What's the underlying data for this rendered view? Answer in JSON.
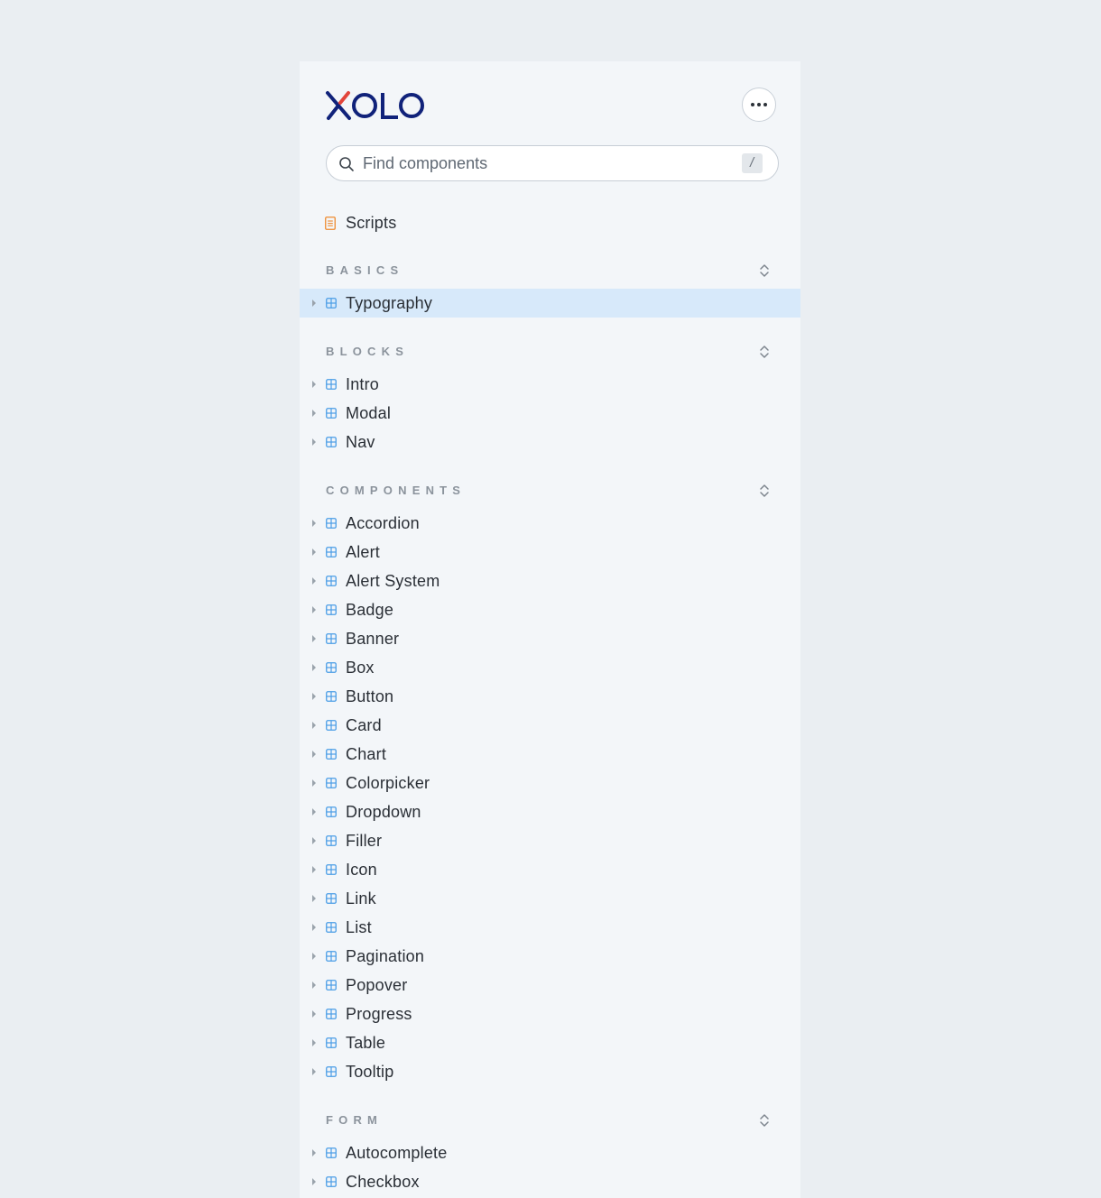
{
  "brand": {
    "logo_text": "XOLO",
    "logo_color": "#10227a",
    "logo_accent_color": "#e2453b"
  },
  "header": {
    "more_icon": "more-horizontal-icon"
  },
  "search": {
    "placeholder": "Find components",
    "value": "",
    "shortcut": "/",
    "icon": "search-icon"
  },
  "colors": {
    "page_background": "#eaeef2",
    "sidebar_background": "#f3f6f9",
    "selected_row": "#d7e9fa",
    "component_icon": "#4a9de6",
    "doc_icon": "#ee8a2f",
    "section_title": "#8b939c"
  },
  "docs": [
    {
      "label": "Scripts",
      "icon": "document-icon"
    }
  ],
  "sections": [
    {
      "title": "BASICS",
      "items": [
        {
          "label": "Typography",
          "selected": true
        }
      ]
    },
    {
      "title": "BLOCKS",
      "items": [
        {
          "label": "Intro"
        },
        {
          "label": "Modal"
        },
        {
          "label": "Nav"
        }
      ]
    },
    {
      "title": "COMPONENTS",
      "items": [
        {
          "label": "Accordion"
        },
        {
          "label": "Alert"
        },
        {
          "label": "Alert System"
        },
        {
          "label": "Badge"
        },
        {
          "label": "Banner"
        },
        {
          "label": "Box"
        },
        {
          "label": "Button"
        },
        {
          "label": "Card"
        },
        {
          "label": "Chart"
        },
        {
          "label": "Colorpicker"
        },
        {
          "label": "Dropdown"
        },
        {
          "label": "Filler"
        },
        {
          "label": "Icon"
        },
        {
          "label": "Link"
        },
        {
          "label": "List"
        },
        {
          "label": "Pagination"
        },
        {
          "label": "Popover"
        },
        {
          "label": "Progress"
        },
        {
          "label": "Table"
        },
        {
          "label": "Tooltip"
        }
      ]
    },
    {
      "title": "FORM",
      "items": [
        {
          "label": "Autocomplete"
        },
        {
          "label": "Checkbox"
        }
      ]
    }
  ]
}
